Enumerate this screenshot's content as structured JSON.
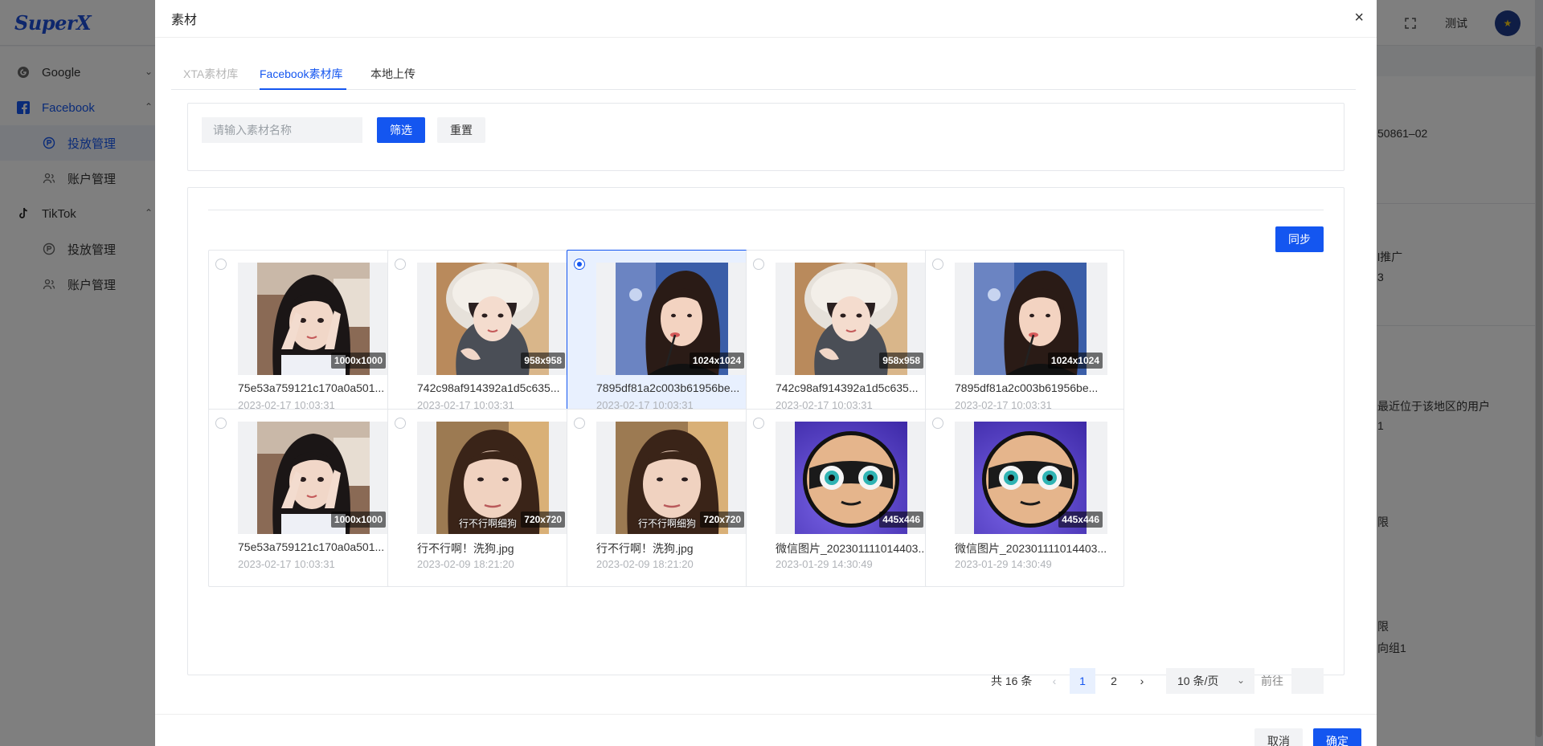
{
  "app": {
    "logo": "SuperX",
    "header_user": "测试",
    "header_icons": [
      "settings-icon",
      "fullscreen-icon"
    ]
  },
  "sidebar": {
    "items": [
      {
        "label": "Google",
        "icon": "google-icon"
      },
      {
        "label": "Facebook",
        "icon": "facebook-icon"
      },
      {
        "label": "投放管理",
        "icon": "ad-icon"
      },
      {
        "label": "账户管理",
        "icon": "users-icon"
      },
      {
        "label": "TikTok",
        "icon": "tiktok-icon"
      },
      {
        "label": "投放管理",
        "icon": "ad-icon"
      },
      {
        "label": "账户管理",
        "icon": "users-icon"
      }
    ]
  },
  "background_main": {
    "texts": [
      "50861–02",
      "l推广",
      "3",
      "最近位于该地区的用户",
      "1",
      "限",
      "限",
      "向组1"
    ]
  },
  "modal": {
    "title": "素材",
    "close": "×",
    "tabs": [
      {
        "label": "XTA素材库",
        "state": "disabled"
      },
      {
        "label": "Facebook素材库",
        "state": "active"
      },
      {
        "label": "本地上传",
        "state": "normal"
      }
    ],
    "filter": {
      "placeholder": "请输入素材名称",
      "value": "",
      "filter_label": "筛选",
      "reset_label": "重置"
    },
    "sync_label": "同步",
    "cards": [
      {
        "name": "75e53a759121c170a0a501...",
        "date": "2023-02-17 10:03:31",
        "dim": "1000x1000",
        "img": "girl-v-sign",
        "selected": false
      },
      {
        "name": "742c98af914392a1d5c635...",
        "date": "2023-02-17 10:03:31",
        "dim": "958x958",
        "img": "girl-fur-hood",
        "selected": false
      },
      {
        "name": "7895df81a2c003b61956be...",
        "date": "2023-02-17 10:03:31",
        "dim": "1024x1024",
        "img": "girl-straw",
        "selected": true
      },
      {
        "name": "742c98af914392a1d5c635...",
        "date": "2023-02-17 10:03:31",
        "dim": "958x958",
        "img": "girl-fur-hood",
        "selected": false
      },
      {
        "name": "7895df81a2c003b61956be...",
        "date": "2023-02-17 10:03:31",
        "dim": "1024x1024",
        "img": "girl-straw",
        "selected": false
      },
      {
        "name": "75e53a759121c170a0a501...",
        "date": "2023-02-17 10:03:31",
        "dim": "1000x1000",
        "img": "girl-v-sign",
        "selected": false
      },
      {
        "name": "行不行啊！洗狗.jpg",
        "date": "2023-02-09 18:21:20",
        "dim": "720x720",
        "img": "girl-selfie",
        "caption": "行不行啊细狗",
        "selected": false
      },
      {
        "name": "行不行啊！洗狗.jpg",
        "date": "2023-02-09 18:21:20",
        "dim": "720x720",
        "img": "girl-selfie",
        "caption": "行不行啊细狗",
        "selected": false
      },
      {
        "name": "微信图片_202301111014403...",
        "date": "2023-01-29 14:30:49",
        "dim": "445x446",
        "img": "mascot",
        "selected": false
      },
      {
        "name": "微信图片_202301111014403...",
        "date": "2023-01-29 14:30:49",
        "dim": "445x446",
        "img": "mascot",
        "selected": false
      }
    ],
    "pagination": {
      "total": "共 16 条",
      "pages": [
        "1",
        "2"
      ],
      "current_page": "1",
      "page_size": "10 条/页",
      "goto_label": "前往",
      "goto_value": ""
    },
    "footer": {
      "cancel_label": "取消",
      "confirm_label": "确定"
    }
  },
  "colors": {
    "primary": "#1456f0",
    "selected_bg": "#e8f0fe"
  }
}
